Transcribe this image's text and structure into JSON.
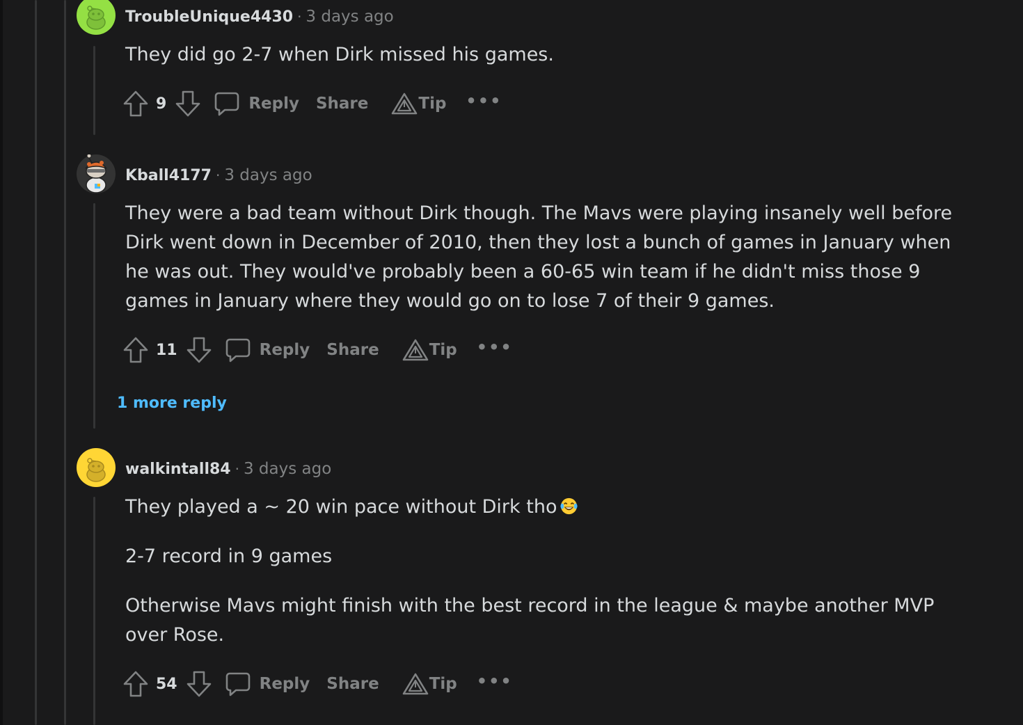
{
  "comments": [
    {
      "username": "TroubleUnique4430",
      "time": "3 days ago",
      "paragraphs": [
        "They did go 2-7 when Dirk missed his games."
      ],
      "votes": "9",
      "reply_label": "Reply",
      "share_label": "Share",
      "tip_label": "Tip",
      "avatar_color": "#94e044"
    },
    {
      "username": "Kball4177",
      "time": "3 days ago",
      "paragraphs": [
        "They were a bad team without Dirk though. The Mavs were playing insanely well before Dirk went down in December of 2010, then they lost a bunch of games in January when he was out. They would've probably been a 60-65 win team if he didn't miss those 9 games in January where they would go on to lose 7 of their 9 games."
      ],
      "votes": "11",
      "reply_label": "Reply",
      "share_label": "Share",
      "tip_label": "Tip",
      "more_replies": "1 more reply",
      "avatar_color": "#333333"
    },
    {
      "username": "walkintall84",
      "time": "3 days ago",
      "paragraphs": [
        "They played a ~ 20 win pace without Dirk tho",
        "2-7 record in 9 games",
        "Otherwise Mavs might finish with the best record in the league & maybe another MVP over Rose."
      ],
      "votes": "54",
      "reply_label": "Reply",
      "share_label": "Share",
      "tip_label": "Tip",
      "avatar_color": "#ffd635"
    }
  ],
  "icons": {
    "upvote": "arrow-up-outline",
    "downvote": "arrow-down-outline",
    "reply": "speech-bubble",
    "tip": "triangle-tip",
    "more": "ellipsis",
    "emoji": "face-with-tears-of-joy"
  },
  "colors": {
    "background": "#1a1a1b",
    "text": "#d7dadc",
    "muted": "#818384",
    "link": "#4fbcff",
    "thread_line": "#343536"
  }
}
